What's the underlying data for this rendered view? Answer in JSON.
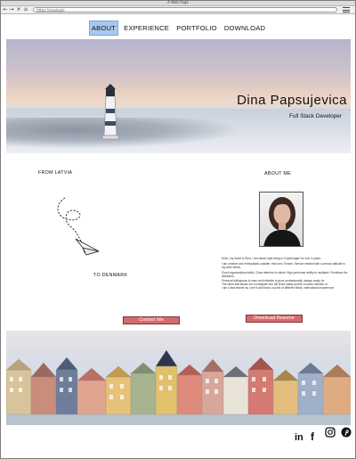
{
  "browser": {
    "title": "A Web Page",
    "url": "https://example"
  },
  "nav": {
    "items": [
      {
        "label": "ABOUT",
        "active": true
      },
      {
        "label": "EXPERIENCE",
        "active": false
      },
      {
        "label": "PORTFOLIO",
        "active": false
      },
      {
        "label": "DOWNLOAD",
        "active": false
      }
    ]
  },
  "hero": {
    "name": "Dina Papsujevica",
    "role": "Full Stack Developer"
  },
  "journey": {
    "from_label": "FROM LATVIA",
    "to_label": "TO DENMARK"
  },
  "about": {
    "heading": "ABOUT ME",
    "paragraphs": [
      "Hello, my name is Dina. I am based right living in Copenhagen for over 4 years.",
      "I am creative and enthusiastic outsider. Has tons Thinker. Service minded with a serious attitude to my work ethics.",
      "Good organizational skills, Close attention to detail. High performer ability to multitask. Prioritises the deadlines.",
      "Personal willingness to learn and initiative to grow professionally, always ready for",
      "The client that allows me to integrate into the team easily and be a useful member of",
      "I am a fast learner as I see it and that is a point of different fields, international experience"
    ]
  },
  "actions": {
    "contact_label": "Contact Me",
    "resume_label": "Download Resume"
  },
  "social": {
    "icons": [
      "linkedin-icon",
      "facebook-icon",
      "instagram-icon",
      "pinterest-icon"
    ],
    "letters": [
      "in",
      "f",
      "",
      ""
    ]
  },
  "colors": {
    "nav_active_bg": "#a9c8ee",
    "button_bg": "#d9696c",
    "button_border": "#7a3336"
  }
}
